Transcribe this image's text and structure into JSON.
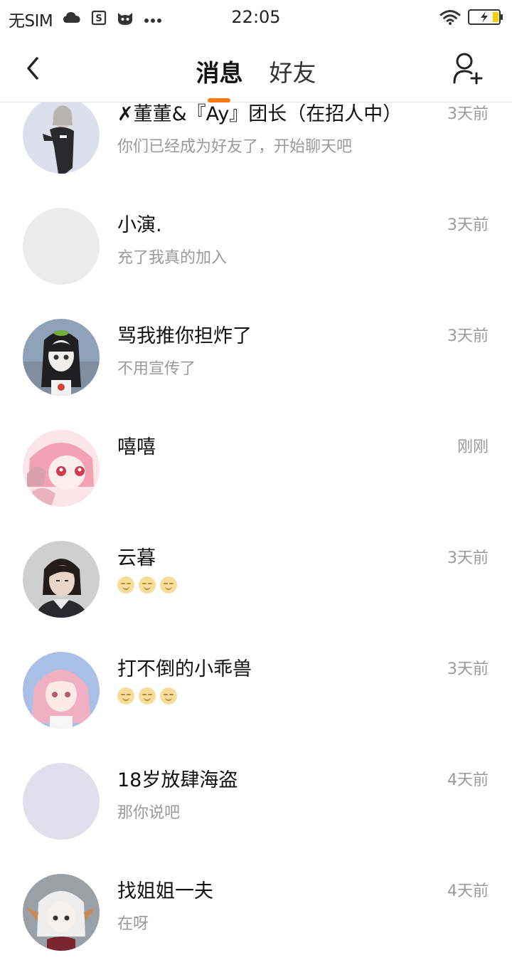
{
  "status_bar": {
    "carrier": "无SIM",
    "time": "22:05",
    "icons": [
      "cloud-icon",
      "s-app-icon",
      "cat-app-icon",
      "more-dots-icon",
      "wifi-icon",
      "battery-charging-icon"
    ]
  },
  "nav": {
    "back_icon": "back-chevron-icon",
    "tabs": [
      {
        "label": "消息",
        "active": true
      },
      {
        "label": "好友",
        "active": false
      }
    ],
    "add_friend_icon": "add-friend-icon",
    "accent_color": "#ff7a14"
  },
  "messages": [
    {
      "name": "✗董董&『Ay』团长（在招人中）",
      "preview": "你们已经成为好友了，开始聊天吧",
      "time": "3天前"
    },
    {
      "name": "小演.",
      "preview": "充了我真的加入",
      "time": "3天前"
    },
    {
      "name": "骂我推你担炸了",
      "preview": "不用宣传了",
      "time": "3天前"
    },
    {
      "name": "嘻嘻",
      "preview": "",
      "time": "刚刚"
    },
    {
      "name": "云暮",
      "preview": "",
      "preview_emojis": [
        "grin-sweat-emoji",
        "grin-sweat-emoji",
        "grin-sweat-emoji"
      ],
      "time": "3天前"
    },
    {
      "name": "打不倒的小乖兽",
      "preview": "",
      "preview_emojis": [
        "wink-emoji",
        "wink-emoji",
        "wink-emoji"
      ],
      "time": "3天前"
    },
    {
      "name": "18岁放肆海盗",
      "preview": "那你说吧",
      "time": "4天前"
    },
    {
      "name": "找姐姐一夫",
      "preview": "在呀",
      "time": "4天前"
    }
  ]
}
